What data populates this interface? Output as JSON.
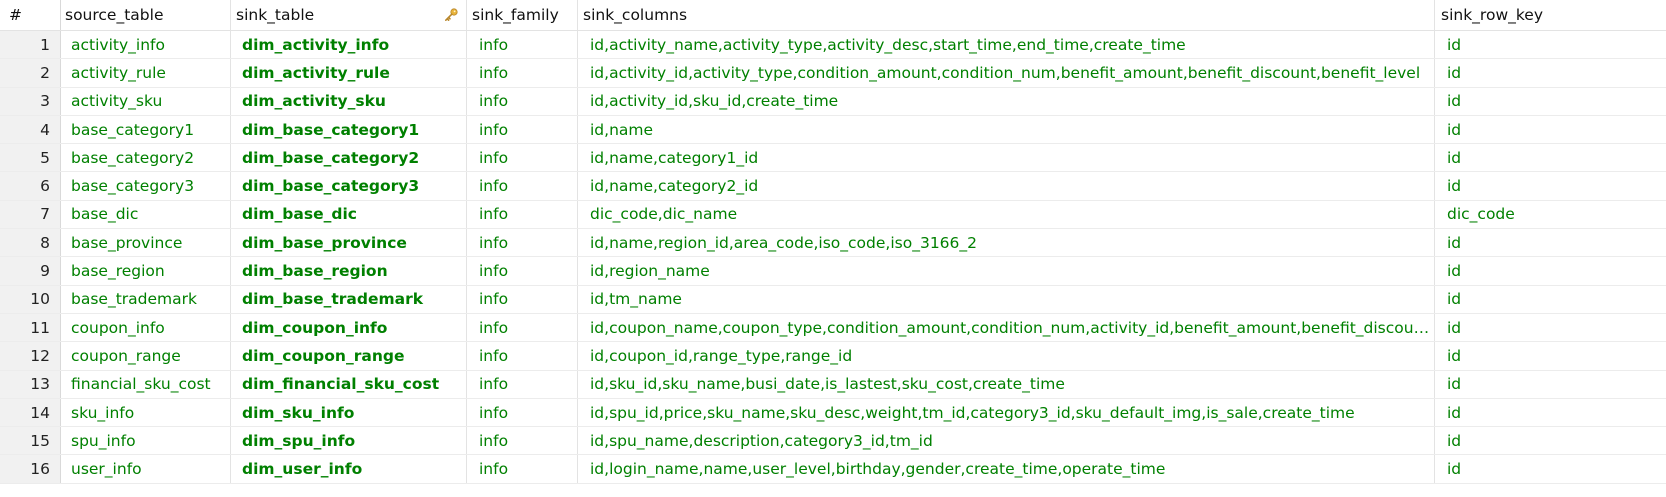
{
  "columns": {
    "num": "#",
    "source_table": "source_table",
    "sink_table": "sink_table",
    "sink_family": "sink_family",
    "sink_columns": "sink_columns",
    "sink_row_key": "sink_row_key"
  },
  "colors": {
    "value_text": "#008000",
    "row_number_bg": "#f1f1f1",
    "key_icon": "#e8b33a"
  },
  "icons": {
    "sink_table_header": "key-icon"
  },
  "rows": [
    {
      "num": "1",
      "source_table": "activity_info",
      "sink_table": "dim_activity_info",
      "sink_family": "info",
      "sink_columns": "id,activity_name,activity_type,activity_desc,start_time,end_time,create_time",
      "sink_row_key": "id"
    },
    {
      "num": "2",
      "source_table": "activity_rule",
      "sink_table": "dim_activity_rule",
      "sink_family": "info",
      "sink_columns": "id,activity_id,activity_type,condition_amount,condition_num,benefit_amount,benefit_discount,benefit_level",
      "sink_row_key": "id"
    },
    {
      "num": "3",
      "source_table": "activity_sku",
      "sink_table": "dim_activity_sku",
      "sink_family": "info",
      "sink_columns": "id,activity_id,sku_id,create_time",
      "sink_row_key": "id"
    },
    {
      "num": "4",
      "source_table": "base_category1",
      "sink_table": "dim_base_category1",
      "sink_family": "info",
      "sink_columns": "id,name",
      "sink_row_key": "id"
    },
    {
      "num": "5",
      "source_table": "base_category2",
      "sink_table": "dim_base_category2",
      "sink_family": "info",
      "sink_columns": "id,name,category1_id",
      "sink_row_key": "id"
    },
    {
      "num": "6",
      "source_table": "base_category3",
      "sink_table": "dim_base_category3",
      "sink_family": "info",
      "sink_columns": "id,name,category2_id",
      "sink_row_key": "id"
    },
    {
      "num": "7",
      "source_table": "base_dic",
      "sink_table": "dim_base_dic",
      "sink_family": "info",
      "sink_columns": "dic_code,dic_name",
      "sink_row_key": "dic_code"
    },
    {
      "num": "8",
      "source_table": "base_province",
      "sink_table": "dim_base_province",
      "sink_family": "info",
      "sink_columns": "id,name,region_id,area_code,iso_code,iso_3166_2",
      "sink_row_key": "id"
    },
    {
      "num": "9",
      "source_table": "base_region",
      "sink_table": "dim_base_region",
      "sink_family": "info",
      "sink_columns": "id,region_name",
      "sink_row_key": "id"
    },
    {
      "num": "10",
      "source_table": "base_trademark",
      "sink_table": "dim_base_trademark",
      "sink_family": "info",
      "sink_columns": "id,tm_name",
      "sink_row_key": "id"
    },
    {
      "num": "11",
      "source_table": "coupon_info",
      "sink_table": "dim_coupon_info",
      "sink_family": "info",
      "sink_columns": "id,coupon_name,coupon_type,condition_amount,condition_num,activity_id,benefit_amount,benefit_discount,cr…",
      "sink_row_key": "id"
    },
    {
      "num": "12",
      "source_table": "coupon_range",
      "sink_table": "dim_coupon_range",
      "sink_family": "info",
      "sink_columns": "id,coupon_id,range_type,range_id",
      "sink_row_key": "id"
    },
    {
      "num": "13",
      "source_table": "financial_sku_cost",
      "sink_table": "dim_financial_sku_cost",
      "sink_family": "info",
      "sink_columns": "id,sku_id,sku_name,busi_date,is_lastest,sku_cost,create_time",
      "sink_row_key": "id"
    },
    {
      "num": "14",
      "source_table": "sku_info",
      "sink_table": "dim_sku_info",
      "sink_family": "info",
      "sink_columns": "id,spu_id,price,sku_name,sku_desc,weight,tm_id,category3_id,sku_default_img,is_sale,create_time",
      "sink_row_key": "id"
    },
    {
      "num": "15",
      "source_table": "spu_info",
      "sink_table": "dim_spu_info",
      "sink_family": "info",
      "sink_columns": "id,spu_name,description,category3_id,tm_id",
      "sink_row_key": "id"
    },
    {
      "num": "16",
      "source_table": "user_info",
      "sink_table": "dim_user_info",
      "sink_family": "info",
      "sink_columns": "id,login_name,name,user_level,birthday,gender,create_time,operate_time",
      "sink_row_key": "id"
    }
  ]
}
